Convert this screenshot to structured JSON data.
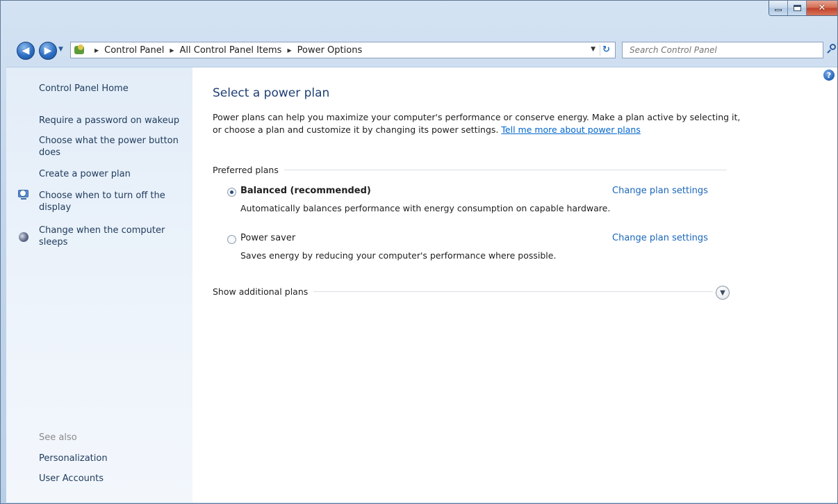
{
  "window": {
    "controls": {
      "minimize": "minimize",
      "maximize": "maximize",
      "close": "x"
    }
  },
  "nav": {
    "back_glyph": "◀",
    "forward_glyph": "▶",
    "breadcrumbs": [
      "Control Panel",
      "All Control Panel Items",
      "Power Options"
    ],
    "search_placeholder": "Search Control Panel"
  },
  "sidebar": {
    "home": "Control Panel Home",
    "links": [
      "Require a password on wakeup",
      "Choose what the power button does",
      "Create a power plan",
      "Choose when to turn off the display",
      "Change when the computer sleeps"
    ],
    "see_also_label": "See also",
    "see_also": [
      "Personalization",
      "User Accounts"
    ]
  },
  "main": {
    "title": "Select a power plan",
    "intro": "Power plans can help you maximize your computer's performance or conserve energy. Make a plan active by selecting it, or choose a plan and customize it by changing its power settings.",
    "intro_link": "Tell me more about power plans",
    "preferred_label": "Preferred plans",
    "plans": [
      {
        "name": "Balanced (recommended)",
        "desc": "Automatically balances performance with energy consumption on capable hardware.",
        "action": "Change plan settings",
        "selected": true
      },
      {
        "name": "Power saver",
        "desc": "Saves energy by reducing your computer's performance where possible.",
        "action": "Change plan settings",
        "selected": false
      }
    ],
    "additional_label": "Show additional plans"
  }
}
